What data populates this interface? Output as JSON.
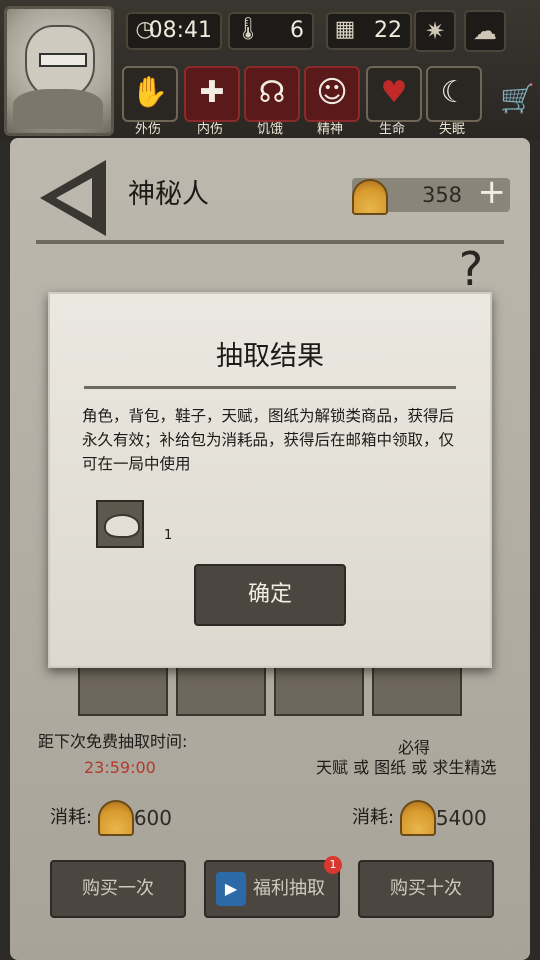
{
  "header": {
    "time": "08:41",
    "temperature": "6",
    "day": "22",
    "status_labels": [
      "外伤",
      "内伤",
      "饥饿",
      "精神",
      "生命",
      "失眠"
    ]
  },
  "page": {
    "title": "神秘人",
    "currency_amount": "358"
  },
  "dialog": {
    "title": "抽取结果",
    "message": "角色，背包，鞋子，天赋，图纸为解锁类商品，获得后永久有效；补给包为消耗品，获得后在邮箱中领取，仅可在一局中使用",
    "reward_count": "1",
    "confirm_label": "确定"
  },
  "draw_info": {
    "free_draw_label": "距下次免费抽取时间:",
    "timer": "23:59:00",
    "guarantee_line1": "必得",
    "guarantee_line2": "天赋 或 图纸 或 求生精选",
    "single_cost_label": "消耗:",
    "single_cost": "600",
    "ten_cost_label": "消耗:",
    "ten_cost": "5400"
  },
  "buttons": {
    "buy_once": "购买一次",
    "bonus_draw": "福利抽取",
    "bonus_badge": "1",
    "buy_ten": "购买十次"
  },
  "colors": {
    "timer": "#b23a2b",
    "badge": "#d9382f",
    "shell": "#e0a83a"
  }
}
